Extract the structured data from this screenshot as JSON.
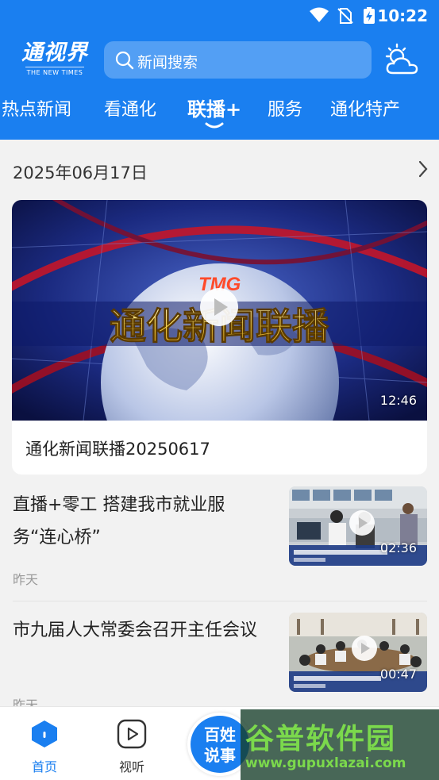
{
  "status_bar": {
    "time": "10:22"
  },
  "header": {
    "logo_cn": "通视界",
    "logo_en": "THE NEW TIMES",
    "search_placeholder": "新闻搜索"
  },
  "tabs": [
    {
      "label": "热点新闻",
      "active": false
    },
    {
      "label": "看通化",
      "active": false
    },
    {
      "label": "联播+",
      "active": true
    },
    {
      "label": "服务",
      "active": false
    },
    {
      "label": "通化特产",
      "active": false
    }
  ],
  "date_header": "2025年06月17日",
  "featured_video": {
    "banner_logo": "TMG",
    "banner_text": "通化新闻联播",
    "duration": "12:46",
    "title": "通化新闻联播20250617"
  },
  "news": [
    {
      "title": "直播+零工 搭建我市就业服务“连心桥”",
      "time": "昨天",
      "duration": "02:36"
    },
    {
      "title": "市九届人大常委会召开主任会议",
      "time": "昨天",
      "duration": "00:47"
    }
  ],
  "bottom_nav": {
    "home": "首页",
    "video": "视听",
    "center_line1": "百姓",
    "center_line2": "说事"
  },
  "watermark": {
    "text": "谷普软件园",
    "url": "www.gupuxlazai.com"
  },
  "colors": {
    "brand_blue": "#1a7ff0",
    "text_dark": "#222222",
    "text_muted": "#999999"
  }
}
